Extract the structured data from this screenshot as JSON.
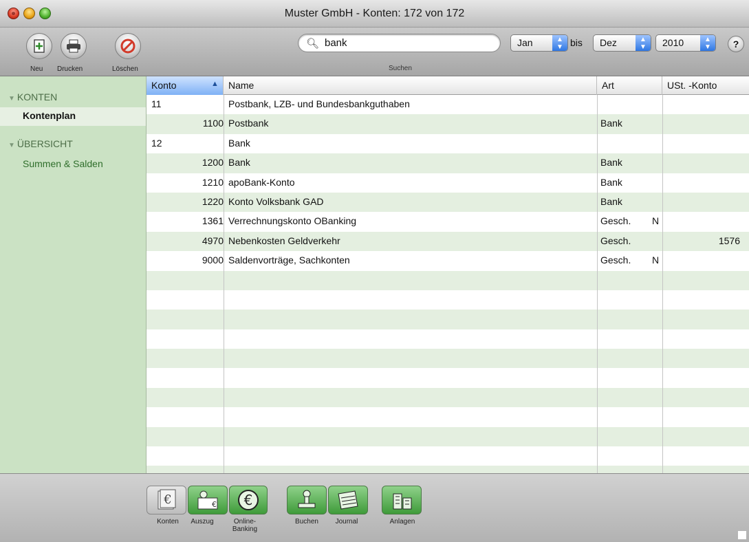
{
  "window": {
    "title": "Muster GmbH - Konten: 172 von 172"
  },
  "toolbar": {
    "new_label": "Neu",
    "print_label": "Drucken",
    "delete_label": "Löschen",
    "search_value": "bank",
    "search_label": "Suchen",
    "from_month": "Jan",
    "bis_label": "bis",
    "to_month": "Dez",
    "year": "2010",
    "help_label": "?"
  },
  "sidebar": {
    "group1": "KONTEN",
    "item1": "Kontenplan",
    "group2": "ÜBERSICHT",
    "item2": "Summen & Salden"
  },
  "table": {
    "columns": [
      "Konto",
      "Name",
      "Art",
      "USt. -Konto"
    ],
    "rows": [
      {
        "konto": "11",
        "name": "Postbank, LZB- und Bundesbankguthaben",
        "art": "",
        "flag": "",
        "ust": ""
      },
      {
        "konto": "1100",
        "name": "Postbank",
        "art": "Bank",
        "flag": "",
        "ust": ""
      },
      {
        "konto": "12",
        "name": "Bank",
        "art": "",
        "flag": "",
        "ust": ""
      },
      {
        "konto": "1200",
        "name": "Bank",
        "art": "Bank",
        "flag": "",
        "ust": ""
      },
      {
        "konto": "1210",
        "name": "apoBank-Konto",
        "art": "Bank",
        "flag": "",
        "ust": ""
      },
      {
        "konto": "1220",
        "name": "Konto Volksbank GAD",
        "art": "Bank",
        "flag": "",
        "ust": ""
      },
      {
        "konto": "1361",
        "name": "Verrechnungskonto OBanking",
        "art": "Gesch.",
        "flag": "N",
        "ust": ""
      },
      {
        "konto": "4970",
        "name": "Nebenkosten Geldverkehr",
        "art": "Gesch.",
        "flag": "",
        "ust": "1576"
      },
      {
        "konto": "9000",
        "name": "Saldenvorträge, Sachkonten",
        "art": "Gesch.",
        "flag": "N",
        "ust": ""
      }
    ]
  },
  "bottombar": {
    "konten": "Konten",
    "auszug": "Auszug",
    "online_line1": "Online-",
    "online_line2": "Banking",
    "buchen": "Buchen",
    "journal": "Journal",
    "anlagen": "Anlagen"
  },
  "colors": {
    "sidebar_bg": "#cbe2c4",
    "row_alt": "#e4efe0",
    "accent_green": "#3f9b3a"
  }
}
